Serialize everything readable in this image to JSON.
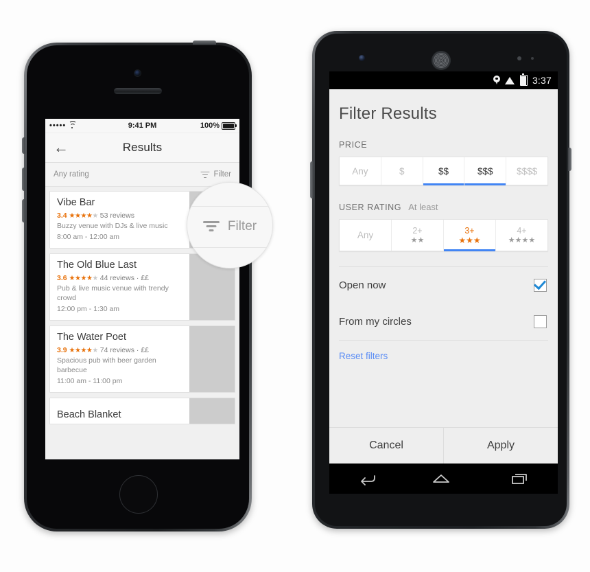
{
  "iphone": {
    "status": {
      "signal_dots": "•••••",
      "wifi_icon": "wifi-icon",
      "time": "9:41 PM",
      "battery_pct": "100%"
    },
    "nav": {
      "back_icon": "back-arrow-icon",
      "title": "Results"
    },
    "filter_bar": {
      "left_label": "Any rating",
      "filter_label": "Filter",
      "filter_icon": "funnel-icon"
    },
    "callout": {
      "label": "Filter",
      "icon": "funnel-icon"
    },
    "results": [
      {
        "name": "Vibe Bar",
        "score": "3.4",
        "stars_filled": "★★★",
        "stars_half": "★",
        "stars_empty": "★",
        "reviews": "53 reviews",
        "price_band": "",
        "description": "Buzzy venue with DJs & live music",
        "hours": "8:00 am - 12:00 am",
        "thumb": "vibe-bar-photo"
      },
      {
        "name": "The Old Blue Last",
        "score": "3.6",
        "stars_filled": "★★★",
        "stars_half": "★",
        "stars_empty": "★",
        "reviews": "44 reviews",
        "price_band": "· ££",
        "description": "Pub & live music venue with trendy crowd",
        "hours": "12:00 pm - 1:30 am",
        "thumb": "old-blue-last-photo"
      },
      {
        "name": "The Water Poet",
        "score": "3.9",
        "stars_filled": "★★★★",
        "stars_half": "",
        "stars_empty": "★",
        "reviews": "74 reviews",
        "price_band": "· ££",
        "description": "Spacious pub with beer garden barbecue",
        "hours": "11:00 am - 11:00 pm",
        "thumb": "water-poet-photo"
      },
      {
        "name": "Beach Blanket",
        "score": "",
        "stars_filled": "",
        "stars_half": "",
        "stars_empty": "",
        "reviews": "",
        "price_band": "",
        "description": "",
        "hours": "",
        "thumb": "beach-blanket-photo"
      }
    ]
  },
  "android": {
    "status": {
      "location_icon": "location-pin-icon",
      "wifi_icon": "wifi-icon",
      "battery_icon": "battery-icon",
      "time": "3:37"
    },
    "title": "Filter Results",
    "price": {
      "label": "PRICE",
      "options": [
        {
          "label": "Any",
          "selected": false
        },
        {
          "label": "$",
          "selected": false
        },
        {
          "label": "$$",
          "selected": true
        },
        {
          "label": "$$$",
          "selected": true
        },
        {
          "label": "$$$$",
          "selected": false
        }
      ]
    },
    "rating": {
      "label": "USER RATING",
      "sublabel": "At least",
      "options": [
        {
          "num": "Any",
          "stars": "",
          "selected": false
        },
        {
          "num": "2+",
          "stars": "★★",
          "selected": false
        },
        {
          "num": "3+",
          "stars": "★★★",
          "selected": true
        },
        {
          "num": "4+",
          "stars": "★★★★",
          "selected": false
        }
      ]
    },
    "toggles": [
      {
        "label": "Open now",
        "checked": true
      },
      {
        "label": "From my circles",
        "checked": false
      }
    ],
    "reset_label": "Reset filters",
    "actions": {
      "cancel": "Cancel",
      "apply": "Apply"
    },
    "navbar": {
      "back_icon": "nav-back-icon",
      "home_icon": "nav-home-icon",
      "recents_icon": "nav-recents-icon"
    }
  },
  "colors": {
    "accent_blue": "#4285f4",
    "rating_orange": "#e8710a",
    "link_blue": "#5b8df5",
    "checkbox_blue": "#1e88d4",
    "android_bg": "#eeeeee",
    "ios_bg": "#f7f7f7"
  }
}
